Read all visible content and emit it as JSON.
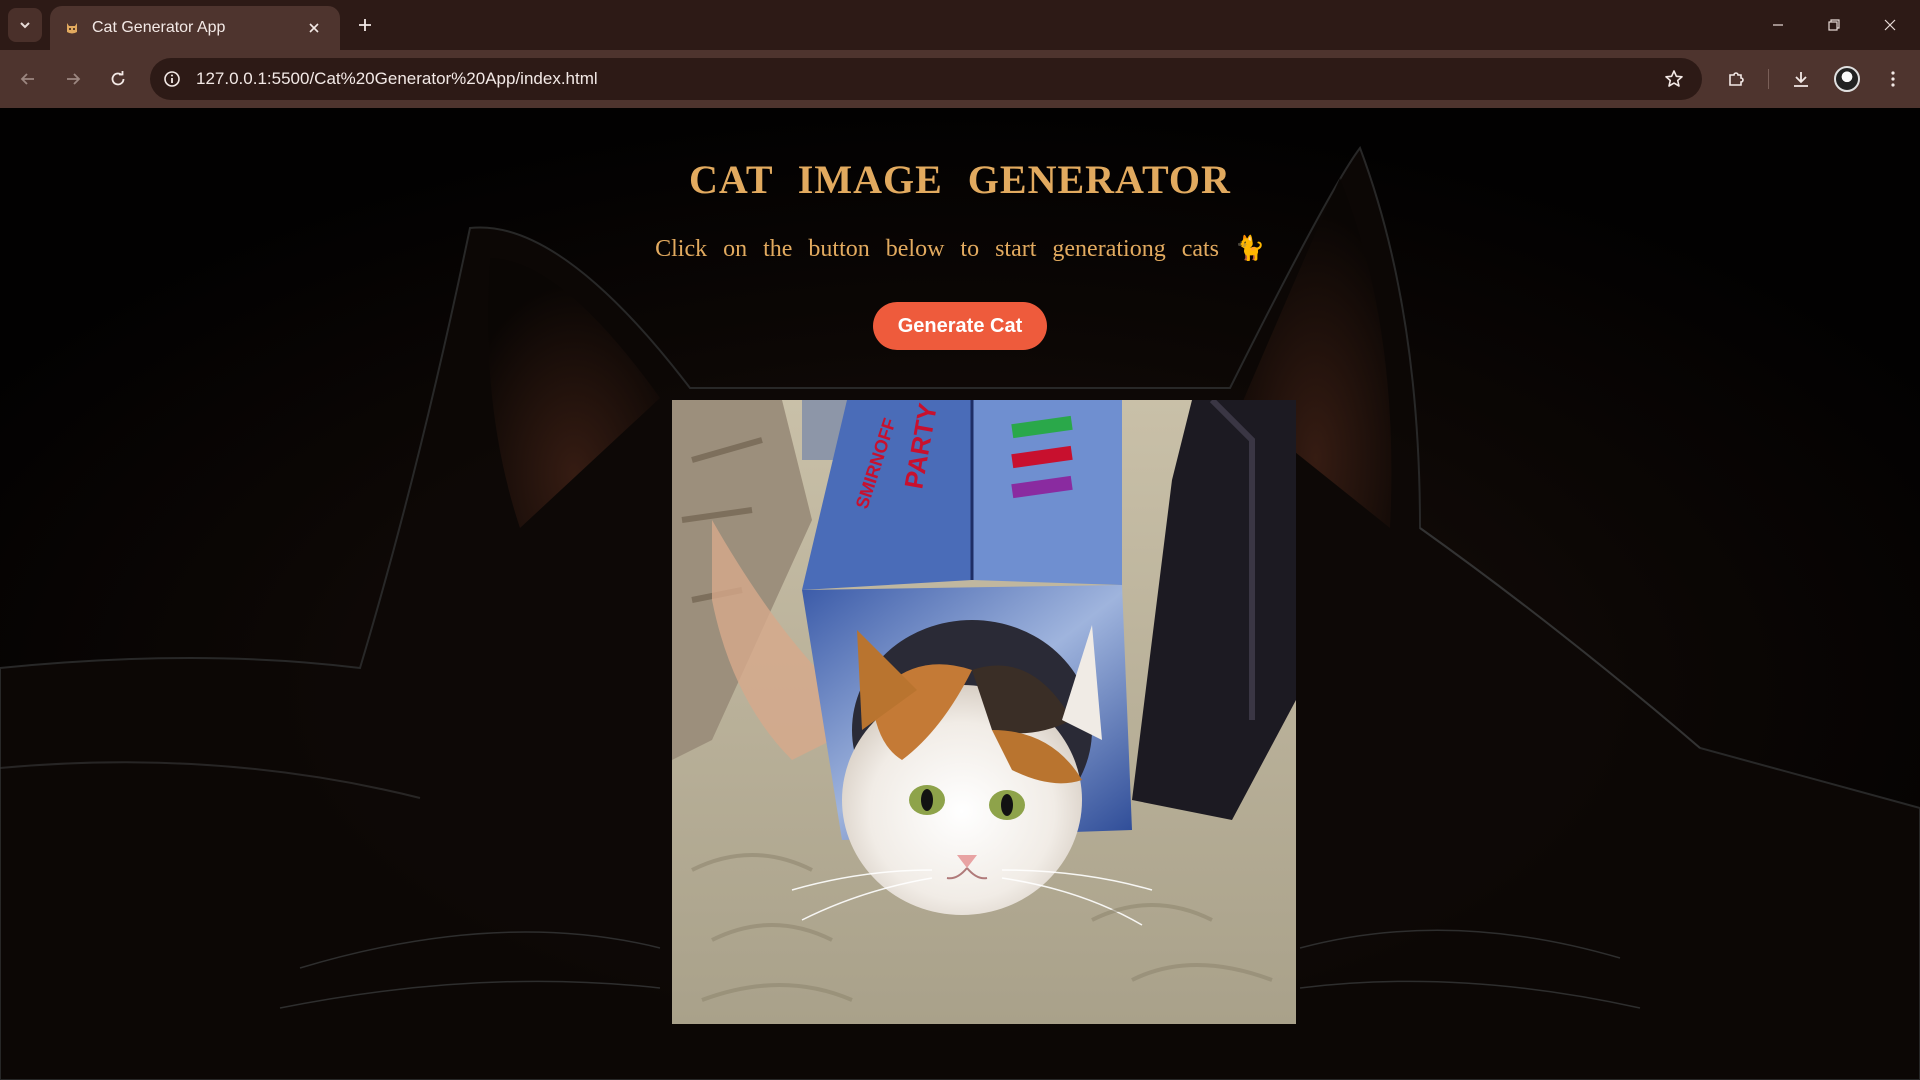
{
  "browser": {
    "tab_title": "Cat Generator App",
    "tab_favicon": "cat-favicon-icon",
    "url": "127.0.0.1:5500/Cat%20Generator%20App/index.html"
  },
  "page": {
    "heading": "CAT IMAGE GENERATOR",
    "subtitle": "Click on the button below to start generationg cats 🐈",
    "button_label": "Generate Cat",
    "image_description": "calico kitten peeking out of a PARTY PACK cardboard box on a shaggy rug",
    "box_text_1": "PARTY PACK",
    "box_text_2": "SMIRNOFF"
  },
  "colors": {
    "heading": "#e2aa5f",
    "button_bg": "#ee5b3c",
    "button_text": "#ffffff",
    "page_bg": "#020101",
    "chrome_tabstrip": "#2d1a16",
    "chrome_toolbar": "#4e342e"
  }
}
